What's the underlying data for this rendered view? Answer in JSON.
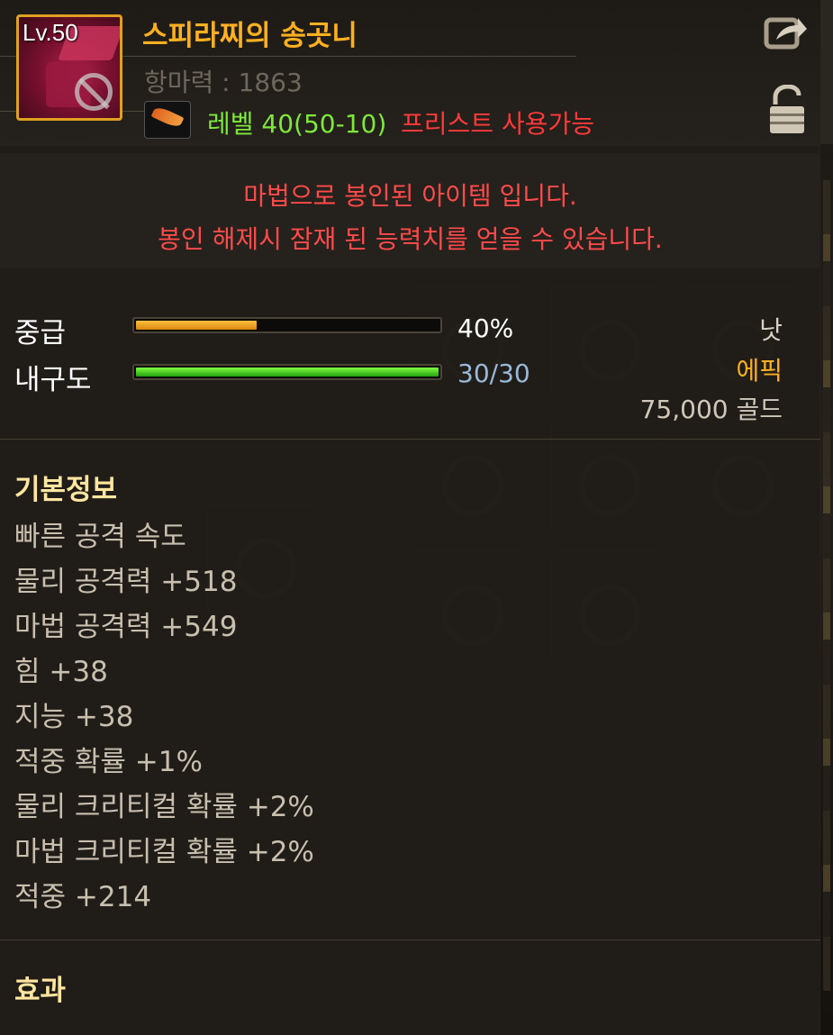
{
  "item": {
    "level_badge": "Lv.50",
    "name": "스피라찌의 송곳니",
    "seal_power": "항마력 : 1863",
    "req_level": "레벨 40(50-10)",
    "req_class": "프리스트 사용가능",
    "icon_name": "dagger-item-icon",
    "class_icon_name": "priest-feather-icon"
  },
  "sealed_notice": {
    "line1": "마법으로 봉인된 아이템 입니다.",
    "line2": "봉인 해제시 잠재 된 능력치를 얻을 수 있습니다."
  },
  "grade": {
    "label": "중급",
    "value_text": "40%",
    "fraction": 0.4
  },
  "durability": {
    "label": "내구도",
    "value_text": "30/30",
    "fraction": 1.0
  },
  "right_info": {
    "type": "낫",
    "rarity": "에픽",
    "price": "75,000 골드"
  },
  "basic_info": {
    "title": "기본정보",
    "stats": [
      "빠른 공격 속도",
      "물리 공격력 +518",
      "마법 공격력 +549",
      "힘 +38",
      "지능 +38",
      "적중 확률 +1%",
      "물리 크리티컬 확률 +2%",
      "마법 크리티컬 확률 +2%",
      "적중 +214"
    ]
  },
  "effects": {
    "title": "효과"
  },
  "colors": {
    "item_name": "#ffb020",
    "rarity_epic": "#ffb020",
    "req_level": "#7ee83a",
    "req_class": "#ff3a3a",
    "sealed_text": "#ff4a4a",
    "grade_bar": "#ffb020",
    "durability_bar": "#5ee02a"
  }
}
